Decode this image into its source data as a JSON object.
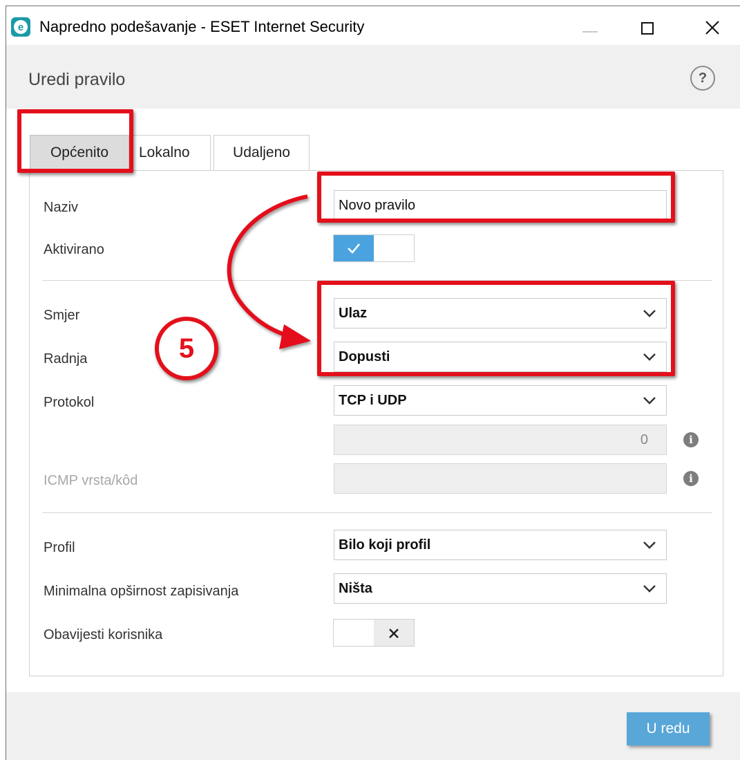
{
  "window": {
    "title": "Napredno podešavanje - ESET Internet Security"
  },
  "header": {
    "title": "Uredi pravilo",
    "help_symbol": "?"
  },
  "tabs": [
    {
      "label": "Općenito",
      "active": true
    },
    {
      "label": "Lokalno",
      "active": false
    },
    {
      "label": "Udaljeno",
      "active": false
    }
  ],
  "form": {
    "name": {
      "label": "Naziv",
      "value": "Novo pravilo"
    },
    "enabled": {
      "label": "Aktivirano",
      "state": "on"
    },
    "direction": {
      "label": "Smjer",
      "value": "Ulaz"
    },
    "action": {
      "label": "Radnja",
      "value": "Dopusti"
    },
    "protocol": {
      "label": "Protokol",
      "value": "TCP i UDP"
    },
    "protocol_number": {
      "value": "0"
    },
    "icmp": {
      "label": "ICMP vrsta/kôd",
      "value": ""
    },
    "profile": {
      "label": "Profil",
      "value": "Bilo koji profil"
    },
    "logging": {
      "label": "Minimalna opširnost zapisivanja",
      "value": "Ništa"
    },
    "notify": {
      "label": "Obavijesti korisnika",
      "state": "off"
    }
  },
  "footer": {
    "ok_label": "U redu"
  },
  "annotation": {
    "step_number": "5",
    "color": "#e3101b"
  },
  "colors": {
    "accent": "#4aa3df",
    "ok_button": "#58a7d8",
    "annotation": "#e3101b"
  }
}
